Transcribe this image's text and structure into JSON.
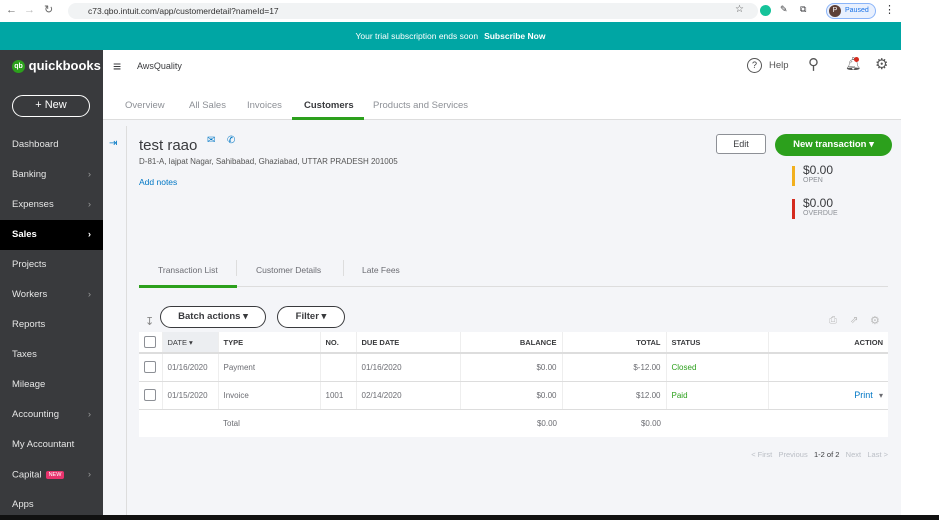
{
  "browser": {
    "url": "c73.qbo.intuit.com/app/customerdetail?nameId=17",
    "profile": "Paused",
    "profile_initial": "P"
  },
  "banner": {
    "text": "Your trial subscription ends soon",
    "link": "Subscribe Now"
  },
  "sidebar": {
    "logo": "quickbooks",
    "logo_small": "intuit",
    "new_label": "New",
    "items": [
      {
        "label": "Dashboard",
        "chev": false
      },
      {
        "label": "Banking",
        "chev": true
      },
      {
        "label": "Expenses",
        "chev": true
      },
      {
        "label": "Sales",
        "chev": true,
        "active": true
      },
      {
        "label": "Projects",
        "chev": false
      },
      {
        "label": "Workers",
        "chev": true
      },
      {
        "label": "Reports",
        "chev": false
      },
      {
        "label": "Taxes",
        "chev": false
      },
      {
        "label": "Mileage",
        "chev": false
      },
      {
        "label": "Accounting",
        "chev": true
      },
      {
        "label": "My Accountant",
        "chev": false
      },
      {
        "label": "Capital",
        "chev": true,
        "badge": "NEW"
      },
      {
        "label": "Apps",
        "chev": false
      }
    ]
  },
  "header": {
    "company": "AwsQuality",
    "help": "Help"
  },
  "tabs": [
    "Overview",
    "All Sales",
    "Invoices",
    "Customers",
    "Products and Services"
  ],
  "customer": {
    "name": "test raao",
    "address": "D-81-A, lajpat Nagar, Sahibabad, Ghaziabad, UTTAR PRADESH 201005",
    "add_notes": "Add notes",
    "edit": "Edit",
    "new_transaction": "New transaction",
    "open_amount": "$0.00",
    "open_label": "OPEN",
    "overdue_amount": "$0.00",
    "overdue_label": "OVERDUE"
  },
  "subtabs": [
    "Transaction List",
    "Customer Details",
    "Late Fees"
  ],
  "toolbar": {
    "batch": "Batch actions",
    "filter": "Filter"
  },
  "table": {
    "headers": [
      "DATE",
      "TYPE",
      "NO.",
      "DUE DATE",
      "BALANCE",
      "TOTAL",
      "STATUS",
      "ACTION"
    ],
    "rows": [
      {
        "date": "01/16/2020",
        "type": "Payment",
        "no": "",
        "due": "01/16/2020",
        "balance": "$0.00",
        "total": "$-12.00",
        "status": "Closed",
        "action": ""
      },
      {
        "date": "01/15/2020",
        "type": "Invoice",
        "no": "1001",
        "due": "02/14/2020",
        "balance": "$0.00",
        "total": "$12.00",
        "status": "Paid",
        "action": "Print"
      }
    ],
    "total_label": "Total",
    "total_balance": "$0.00",
    "total_total": "$0.00"
  },
  "pagination": {
    "first": "< First",
    "previous": "Previous",
    "range": "1-2 of 2",
    "next": "Next",
    "last": "Last >"
  },
  "colors": {
    "teal": "#00a6a4",
    "green": "#2ca01c",
    "open": "#f2b01e",
    "overdue": "#d52b1e"
  }
}
